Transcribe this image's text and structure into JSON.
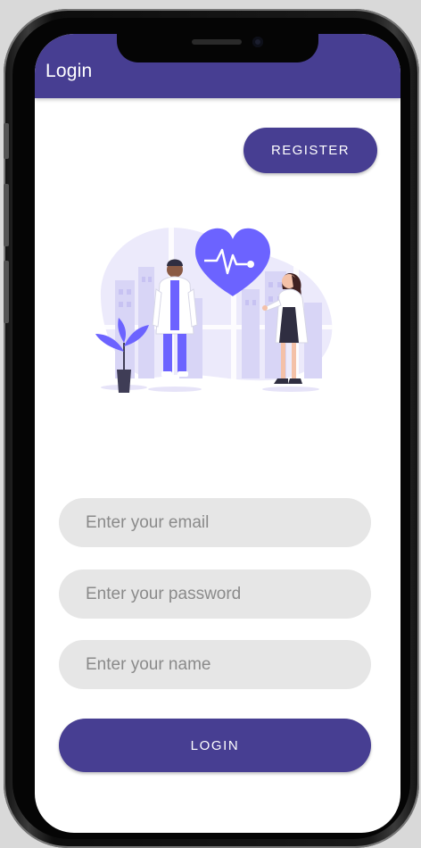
{
  "appbar": {
    "title": "Login"
  },
  "register_button": {
    "label": "REGISTER"
  },
  "illustration": {
    "icon": "doctors-heart-illustration"
  },
  "form": {
    "email_placeholder": "Enter your email",
    "password_placeholder": "Enter your password",
    "name_placeholder": "Enter your name"
  },
  "login_button": {
    "label": "LOGIN"
  },
  "colors": {
    "primary": "#473e92",
    "field_bg": "#e6e6e6",
    "placeholder": "#8a8a8a",
    "accent_illustration": "#6c63ff"
  }
}
